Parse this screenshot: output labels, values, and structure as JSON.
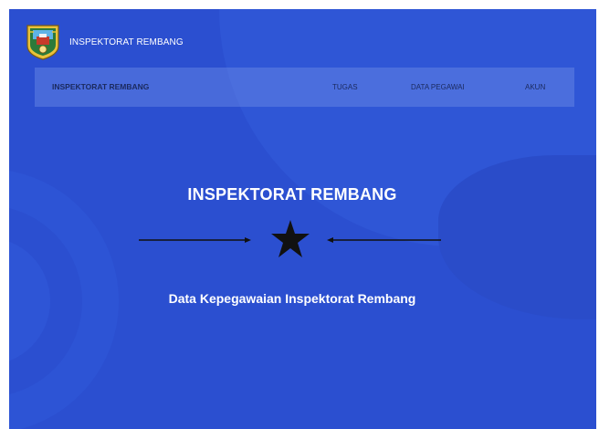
{
  "header": {
    "brand_text": "INSPEKTORAT REMBANG"
  },
  "navbar": {
    "brand": "INSPEKTORAT REMBANG",
    "items": [
      {
        "label": "TUGAS"
      },
      {
        "label": "DATA PEGAWAI"
      },
      {
        "label": "AKUN"
      }
    ]
  },
  "hero": {
    "title": "INSPEKTORAT REMBANG",
    "subtitle": "Data Kepegawaian Inspektorat Rembang"
  },
  "icons": {
    "logo": "regency-emblem-icon",
    "divider": "star-icon"
  },
  "colors": {
    "background": "#2b4fd0",
    "navbar_text": "#1b2a5e",
    "text": "#ffffff",
    "star": "#111111"
  }
}
